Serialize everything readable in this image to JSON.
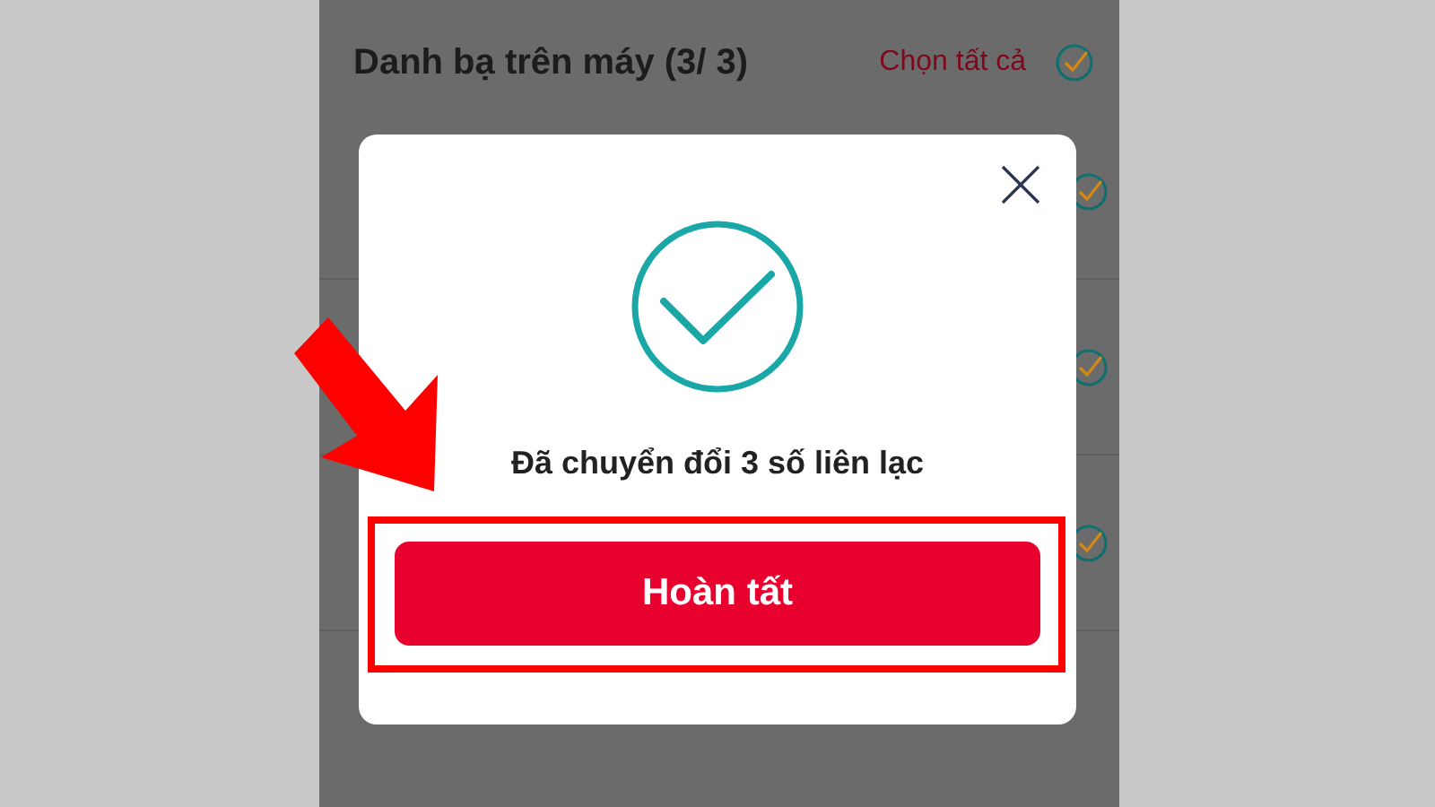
{
  "header": {
    "title": "Danh bạ trên máy (3/ 3)",
    "select_all": "Chọn tất cả",
    "all_selected": true
  },
  "contacts": [
    {
      "checked": true
    },
    {
      "checked": true
    },
    {
      "checked": true
    }
  ],
  "dialog": {
    "message": "Đã chuyển đổi 3 số liên lạc",
    "button": "Hoàn tất"
  }
}
